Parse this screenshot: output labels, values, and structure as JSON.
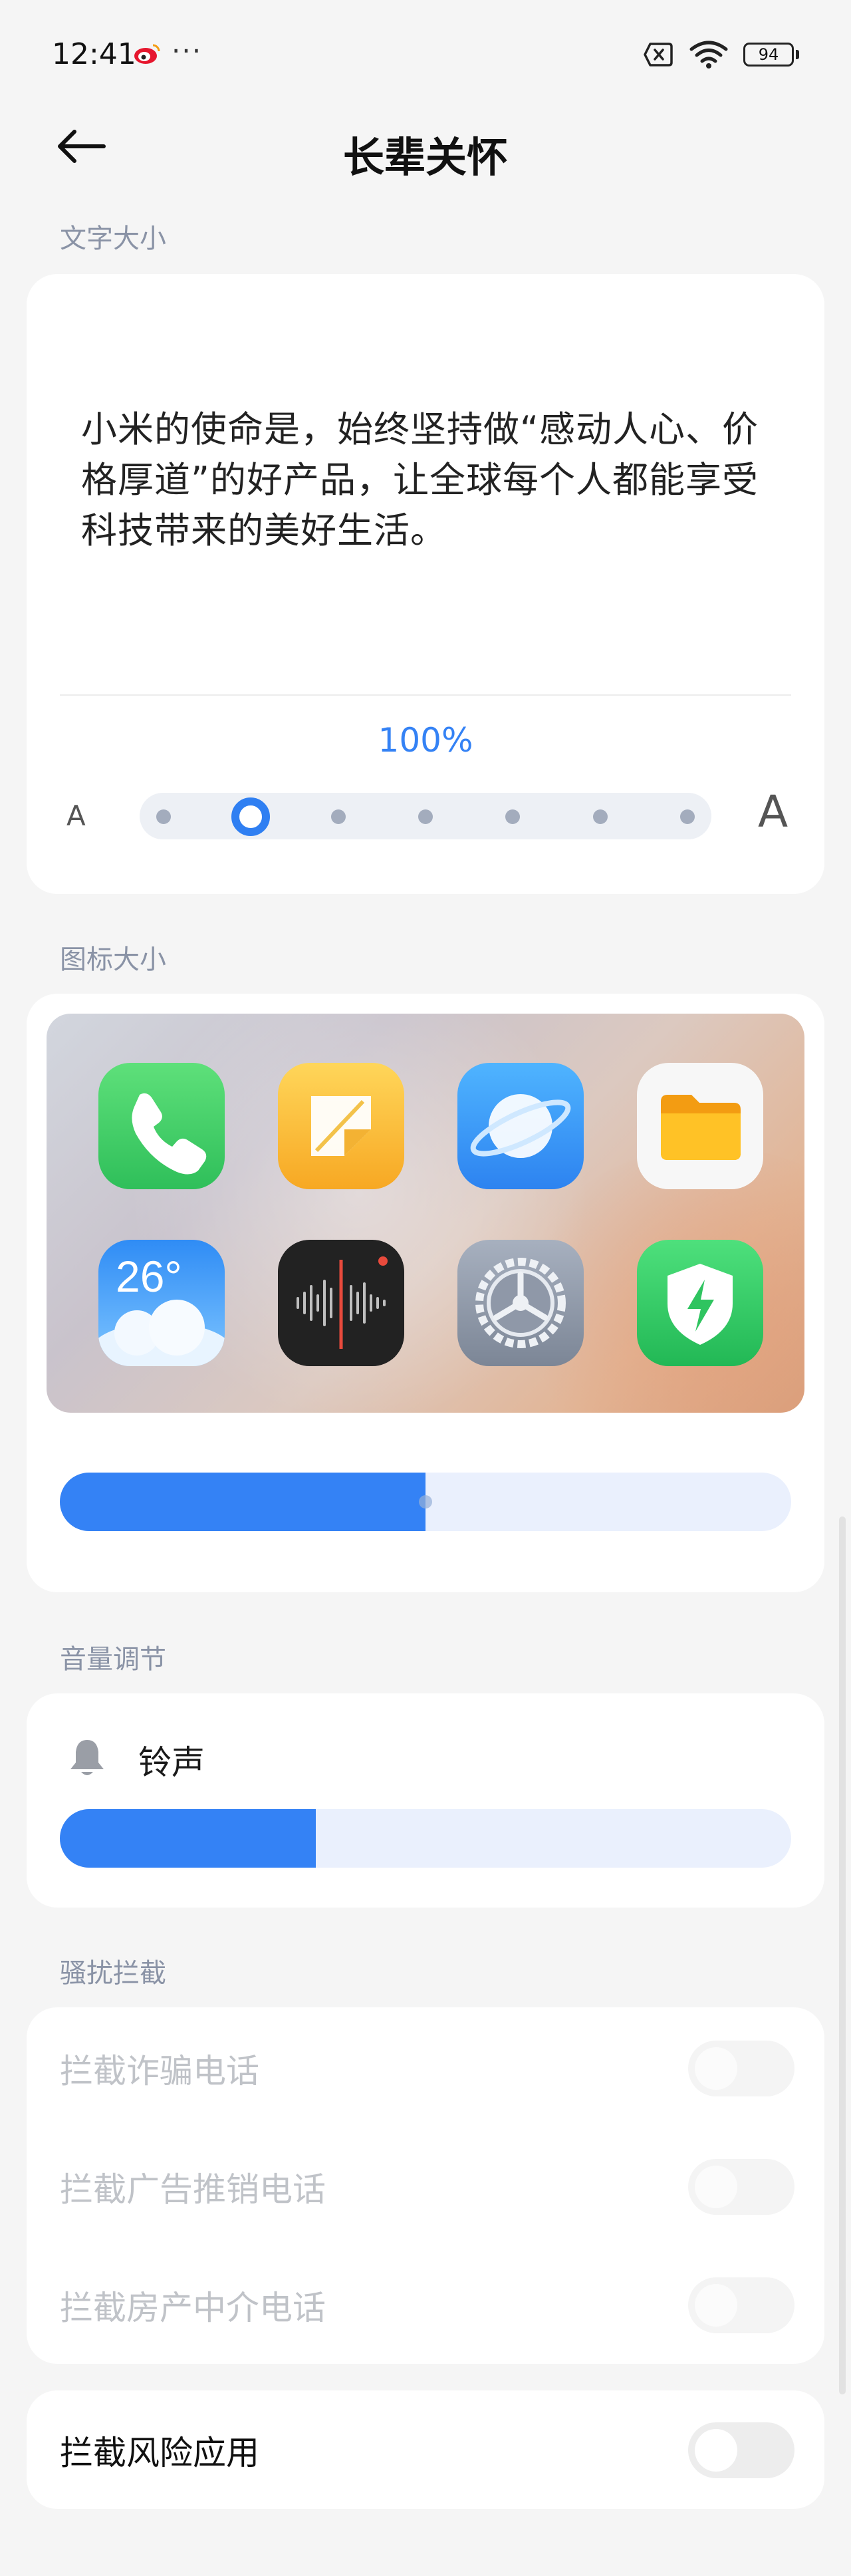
{
  "status_bar": {
    "time": "12:41",
    "more": "···",
    "battery": "94",
    "icons": [
      "weibo-icon",
      "sim-off-icon",
      "wifi-icon",
      "battery-icon"
    ]
  },
  "header": {
    "title": "长辈关怀",
    "back_icon": "arrow-left-icon"
  },
  "text_size": {
    "section_label": "文字大小",
    "sample": "小米的使命是，始终坚持做“感动人心、价格厚道”的好产品，让全球每个人都能享受科技带来的美好生活。",
    "percent": "100%",
    "small_a": "A",
    "large_a": "A",
    "steps_total": 7,
    "selected_step": 2
  },
  "icon_size": {
    "section_label": "图标大小",
    "apps": [
      {
        "name": "phone",
        "icon": "phone-icon"
      },
      {
        "name": "notes",
        "icon": "notes-icon"
      },
      {
        "name": "browser",
        "icon": "browser-icon"
      },
      {
        "name": "files",
        "icon": "folder-icon"
      },
      {
        "name": "weather",
        "icon": "weather-icon",
        "text": "26°"
      },
      {
        "name": "recorder",
        "icon": "recorder-icon"
      },
      {
        "name": "settings",
        "icon": "settings-icon"
      },
      {
        "name": "security",
        "icon": "security-icon"
      }
    ],
    "slider_fraction": 0.5
  },
  "volume": {
    "section_label": "音量调节",
    "ringtone_label": "铃声",
    "bell_icon": "bell-icon",
    "slider_fraction": 0.35
  },
  "harassment": {
    "section_label": "骚扰拦截",
    "rows": [
      {
        "label": "拦截诈骗电话",
        "on": false,
        "enabled": false
      },
      {
        "label": "拦截广告推销电话",
        "on": false,
        "enabled": false
      },
      {
        "label": "拦截房产中介电话",
        "on": false,
        "enabled": false
      }
    ]
  },
  "risk_apps": {
    "label": "拦截风险应用",
    "on": false
  },
  "colors": {
    "accent": "#3482f5",
    "background": "#f5f5f5",
    "section_label": "#8a93a6"
  }
}
